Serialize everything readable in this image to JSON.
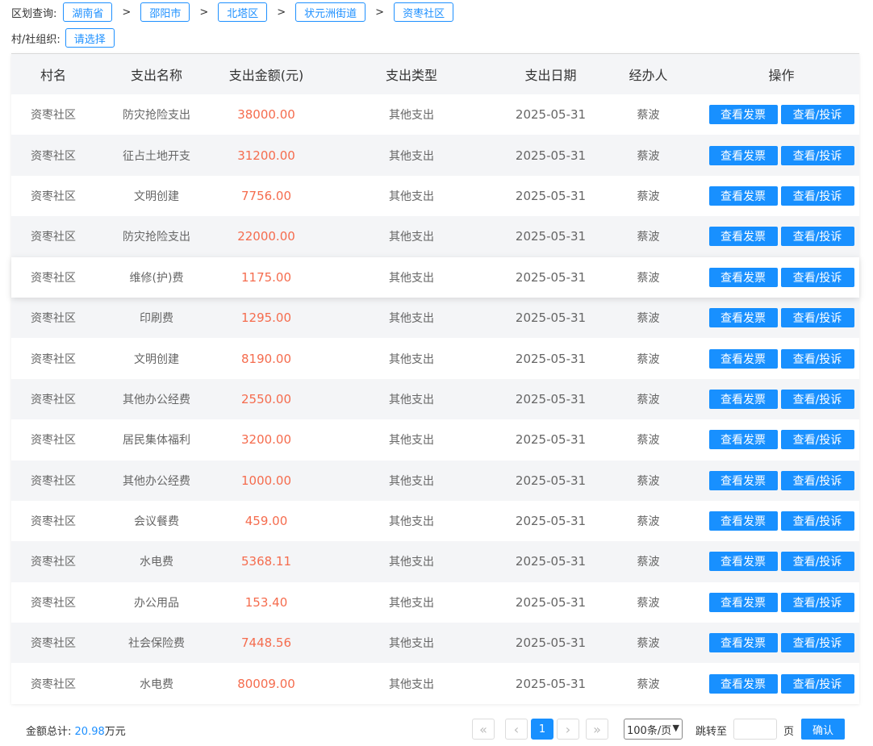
{
  "region": {
    "label": "区划查询:",
    "items": [
      "湖南省",
      "邵阳市",
      "北塔区",
      "状元洲街道",
      "资枣社区"
    ],
    "separator": ">"
  },
  "org": {
    "label": "村/社组织:",
    "select_label": "请选择"
  },
  "table": {
    "headers": [
      "村名",
      "支出名称",
      "支出金额(元)",
      "支出类型",
      "支出日期",
      "经办人",
      "操作"
    ],
    "actions": {
      "invoice": "查看发票",
      "complain": "查看/投诉"
    },
    "rows": [
      {
        "village": "资枣社区",
        "name": "防灾抢险支出",
        "amount": "38000.00",
        "type": "其他支出",
        "date": "2025-05-31",
        "handler": "蔡波"
      },
      {
        "village": "资枣社区",
        "name": "征占土地开支",
        "amount": "31200.00",
        "type": "其他支出",
        "date": "2025-05-31",
        "handler": "蔡波"
      },
      {
        "village": "资枣社区",
        "name": "文明创建",
        "amount": "7756.00",
        "type": "其他支出",
        "date": "2025-05-31",
        "handler": "蔡波"
      },
      {
        "village": "资枣社区",
        "name": "防灾抢险支出",
        "amount": "22000.00",
        "type": "其他支出",
        "date": "2025-05-31",
        "handler": "蔡波"
      },
      {
        "village": "资枣社区",
        "name": "维修(护)费",
        "amount": "1175.00",
        "type": "其他支出",
        "date": "2025-05-31",
        "handler": "蔡波"
      },
      {
        "village": "资枣社区",
        "name": "印刷费",
        "amount": "1295.00",
        "type": "其他支出",
        "date": "2025-05-31",
        "handler": "蔡波"
      },
      {
        "village": "资枣社区",
        "name": "文明创建",
        "amount": "8190.00",
        "type": "其他支出",
        "date": "2025-05-31",
        "handler": "蔡波"
      },
      {
        "village": "资枣社区",
        "name": "其他办公经费",
        "amount": "2550.00",
        "type": "其他支出",
        "date": "2025-05-31",
        "handler": "蔡波"
      },
      {
        "village": "资枣社区",
        "name": "居民集体福利",
        "amount": "3200.00",
        "type": "其他支出",
        "date": "2025-05-31",
        "handler": "蔡波"
      },
      {
        "village": "资枣社区",
        "name": "其他办公经费",
        "amount": "1000.00",
        "type": "其他支出",
        "date": "2025-05-31",
        "handler": "蔡波"
      },
      {
        "village": "资枣社区",
        "name": "会议餐费",
        "amount": "459.00",
        "type": "其他支出",
        "date": "2025-05-31",
        "handler": "蔡波"
      },
      {
        "village": "资枣社区",
        "name": "水电费",
        "amount": "5368.11",
        "type": "其他支出",
        "date": "2025-05-31",
        "handler": "蔡波"
      },
      {
        "village": "资枣社区",
        "name": "办公用品",
        "amount": "153.40",
        "type": "其他支出",
        "date": "2025-05-31",
        "handler": "蔡波"
      },
      {
        "village": "资枣社区",
        "name": "社会保险费",
        "amount": "7448.56",
        "type": "其他支出",
        "date": "2025-05-31",
        "handler": "蔡波"
      },
      {
        "village": "资枣社区",
        "name": "水电费",
        "amount": "80009.00",
        "type": "其他支出",
        "date": "2025-05-31",
        "handler": "蔡波"
      }
    ]
  },
  "footer": {
    "total_label": "金额总计:",
    "total_value": "20.98",
    "total_unit": "万元",
    "page_first": "«",
    "page_prev": "‹",
    "page_current": "1",
    "page_next": "›",
    "page_last": "»",
    "page_size": "100条/页",
    "jump_label": "跳转至",
    "page_unit": "页",
    "confirm": "确认"
  },
  "colors": {
    "accent": "#1890ff",
    "amount": "#f56c4e",
    "stripe": "#f4f5f7"
  }
}
